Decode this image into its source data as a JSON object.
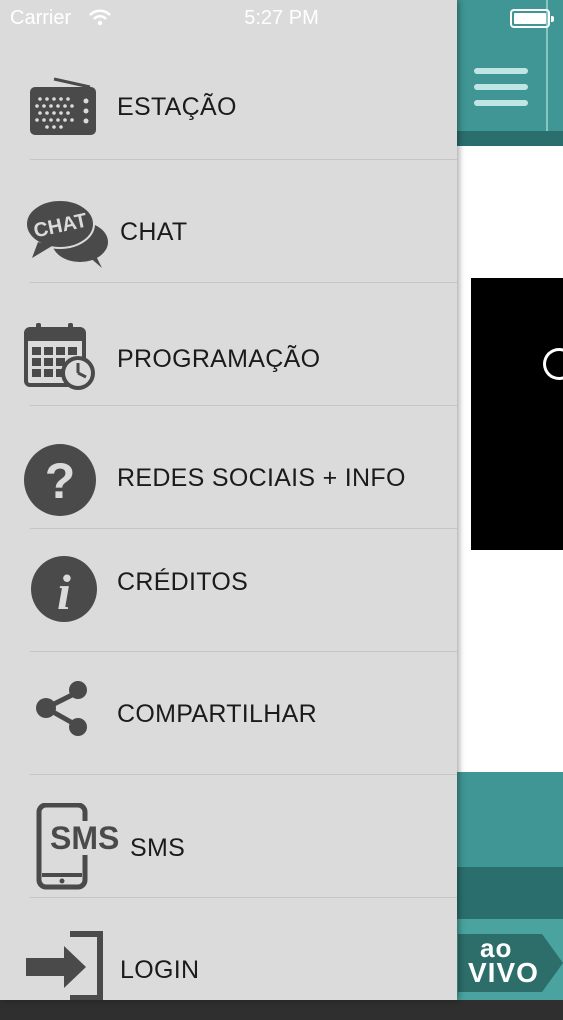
{
  "status_bar": {
    "carrier": "Carrier",
    "time": "5:27 PM"
  },
  "menu": {
    "items": [
      {
        "label": "ESTAÇÃO",
        "icon": "radio-icon"
      },
      {
        "label": "CHAT",
        "icon": "chat-bubbles-icon"
      },
      {
        "label": "PROGRAMAÇÃO",
        "icon": "calendar-clock-icon"
      },
      {
        "label": "REDES SOCIAIS + INFO",
        "icon": "question-circle-icon"
      },
      {
        "label": "CRÉDITOS",
        "icon": "info-circle-icon"
      },
      {
        "label": "COMPARTILHAR",
        "icon": "share-icon"
      },
      {
        "label": "SMS",
        "icon": "sms-phone-icon"
      },
      {
        "label": "LOGIN",
        "icon": "login-arrow-icon"
      }
    ]
  },
  "chat_icon_text": "CHAT",
  "sms_icon_text": "SMS",
  "live_badge": {
    "line1": "ao",
    "line2": "VIVO"
  },
  "colors": {
    "drawer": "#dcdbdc",
    "accent": "#3f9694",
    "accent_dark": "#2a6f6d",
    "icon": "#4a4a4a"
  }
}
